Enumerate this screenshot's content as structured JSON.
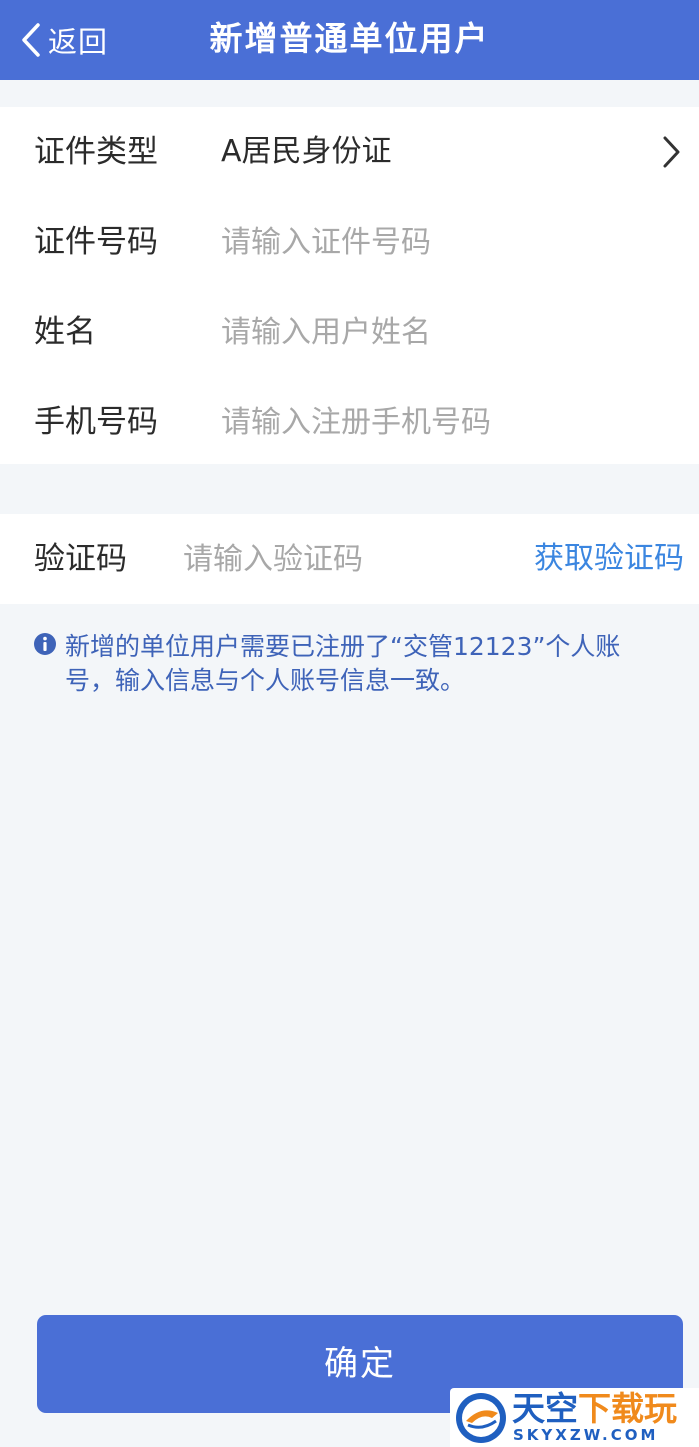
{
  "header": {
    "back_label": "返回",
    "title": "新增普通单位用户"
  },
  "form": {
    "id_type": {
      "label": "证件类型",
      "value": "A居民身份证"
    },
    "id_number": {
      "label": "证件号码",
      "placeholder": "请输入证件号码"
    },
    "name": {
      "label": "姓名",
      "placeholder": "请输入用户姓名"
    },
    "phone": {
      "label": "手机号码",
      "placeholder": "请输入注册手机号码"
    },
    "verify": {
      "label": "验证码",
      "placeholder": "请输入验证码",
      "get_code_label": "获取验证码"
    }
  },
  "notice": {
    "icon": "info-icon",
    "text": "新增的单位用户需要已注册了“交管12123”个人账号，输入信息与个人账号信息一致。"
  },
  "confirm_label": "确定",
  "watermark": {
    "main_part1": "天空",
    "main_part2": "下载玩",
    "sub": "SKYXZW.COM"
  },
  "colors": {
    "primary": "#4a6fd6",
    "link": "#3b86e0",
    "notice_text": "#3e63b8",
    "background": "#f3f6f9"
  }
}
